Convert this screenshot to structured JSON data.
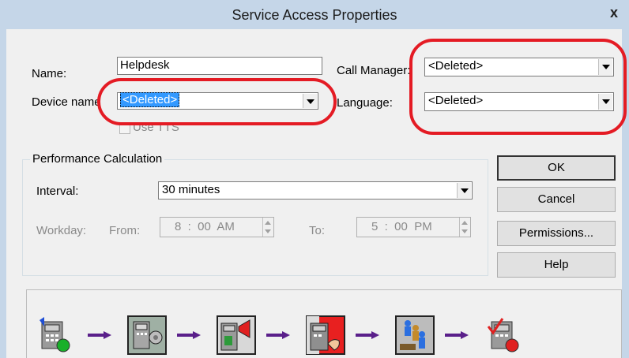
{
  "window": {
    "title": "Service Access Properties",
    "close_glyph": "x"
  },
  "fields": {
    "name_label": "Name:",
    "name_value": "Helpdesk",
    "device_label": "Device name",
    "device_value": "<Deleted>",
    "use_tts_label": "Use TTS",
    "call_manager_label": "Call Manager:",
    "call_manager_value": "<Deleted>",
    "language_label": "Language:",
    "language_value": "<Deleted>"
  },
  "performance": {
    "group_title": "Performance Calculation",
    "interval_label": "Interval:",
    "interval_value": "30 minutes",
    "workday_label": "Workday:",
    "from_label": "From:",
    "from_value": "8  :  00  AM",
    "to_label": "To:",
    "to_value": "5  :  00  PM"
  },
  "buttons": {
    "ok": "OK",
    "cancel": "Cancel",
    "permissions": "Permissions...",
    "help": "Help"
  },
  "flow_icons": [
    "phone-ringing-icon",
    "phone-speaker-icon",
    "phone-megaphone-icon",
    "phone-hand-icon",
    "agents-queue-icon",
    "phone-checkmark-icon"
  ],
  "colors": {
    "titlebar": "#c5d6e8",
    "dialog_bg": "#f0f0f0",
    "selection": "#3399ff",
    "annotation_red": "#e41b24",
    "flow_arrow": "#5a1f8a"
  }
}
